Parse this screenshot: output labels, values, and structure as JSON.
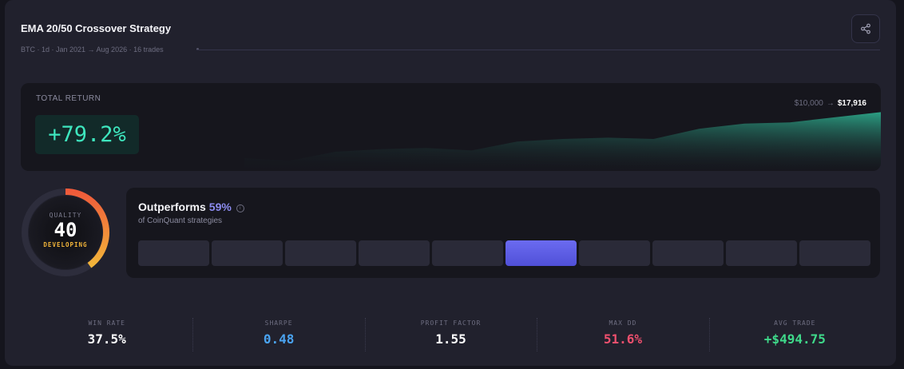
{
  "header": {
    "title": "EMA 20/50 Crossover Strategy",
    "subtitle": "BTC · 1d · Jan 2021 → Aug 2026 · 16 trades"
  },
  "icons": {
    "share": "share-icon",
    "info": "info-icon"
  },
  "total_return": {
    "label": "TOTAL RETURN",
    "value": "+79.2%",
    "start_equity": "$10,000",
    "arrow": "→",
    "end_equity": "$17,916",
    "equity_curve": [
      1.0,
      0.98,
      1.05,
      1.07,
      1.08,
      1.06,
      1.13,
      1.15,
      1.16,
      1.15,
      1.23,
      1.27,
      1.28,
      1.32,
      1.36
    ]
  },
  "quality": {
    "label": "QUALITY",
    "score": "40",
    "tier": "DEVELOPING",
    "fraction": 0.4
  },
  "outperforms": {
    "label": "Outperforms",
    "percent": "59%",
    "subtitle": "of CoinQuant strategies",
    "bins_count": 10,
    "active_bin": 5
  },
  "stats": [
    {
      "label": "WIN RATE",
      "value": "37.5%",
      "color": "#ffffff"
    },
    {
      "label": "SHARPE",
      "value": "0.48",
      "color": "#4aa3f0"
    },
    {
      "label": "PROFIT FACTOR",
      "value": "1.55",
      "color": "#ffffff"
    },
    {
      "label": "MAX DD",
      "value": "51.6%",
      "color": "#f0506e"
    },
    {
      "label": "AVG TRADE",
      "value": "+$494.75",
      "color": "#3fd98a"
    }
  ],
  "colors": {
    "accent_teal": "#3ee6be",
    "accent_purple": "#8c8cf0",
    "gauge_start": "#f05a3a",
    "gauge_end": "#f2b53a"
  }
}
